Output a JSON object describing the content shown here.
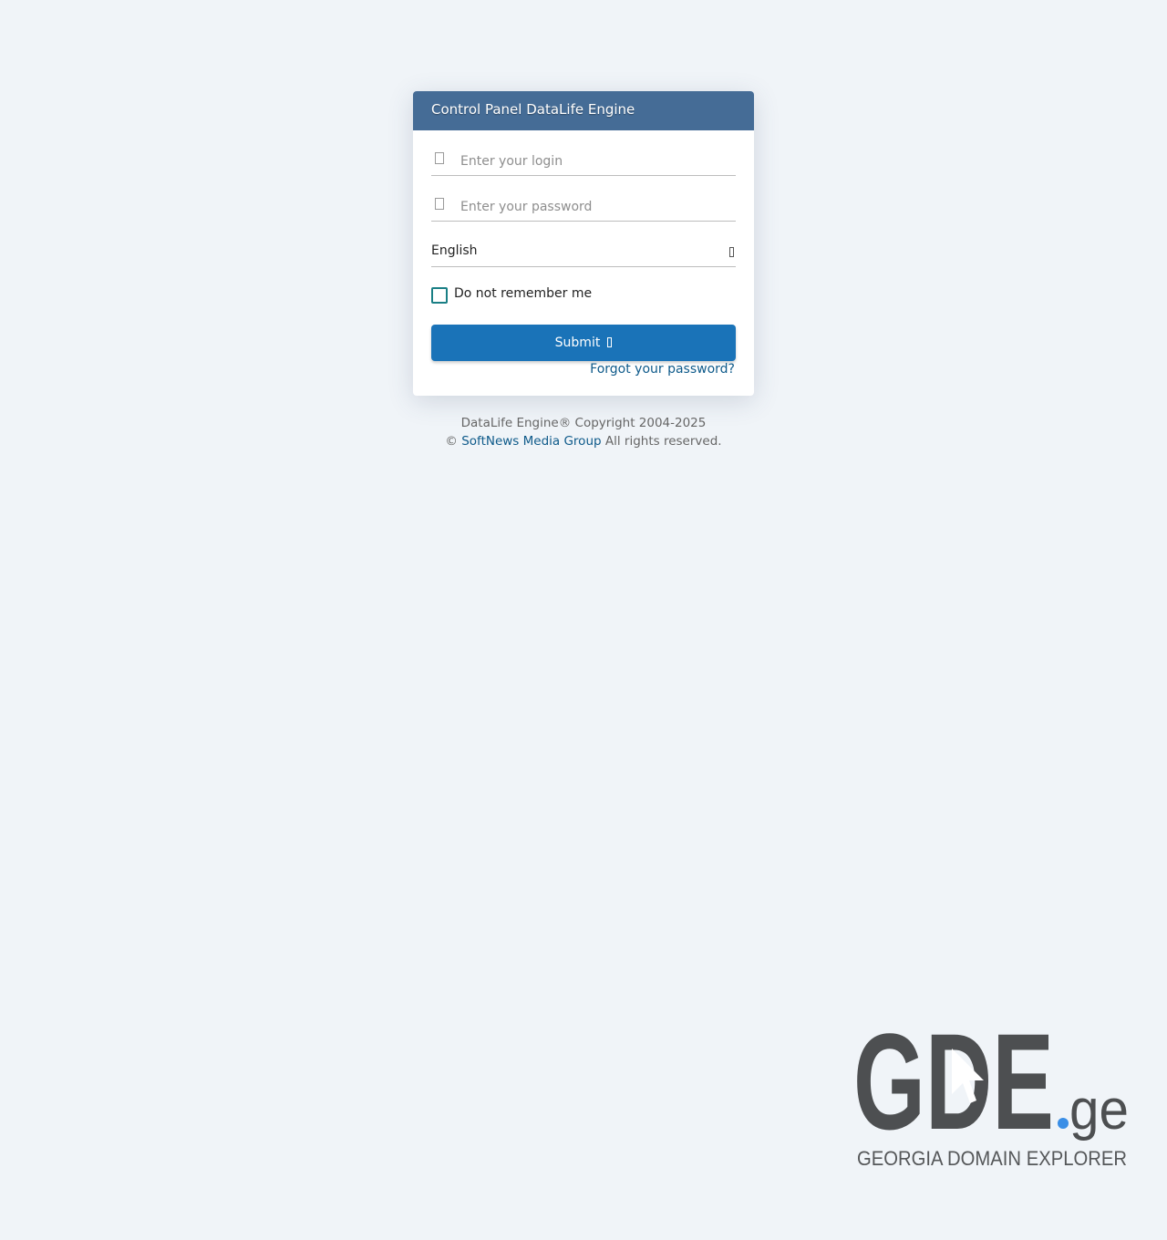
{
  "login_panel": {
    "title": "Control Panel DataLife Engine",
    "login_field": {
      "placeholder": "Enter your login",
      "value": "",
      "icon": "user-icon"
    },
    "password_field": {
      "placeholder": "Enter your password",
      "value": "",
      "icon": "lock-icon"
    },
    "language_select": {
      "value": "English",
      "icon": "chevron-down-icon"
    },
    "remember_checkbox": {
      "label": "Do not remember me",
      "checked": false
    },
    "submit_button": {
      "label": "Submit",
      "icon": "sign-in-icon"
    },
    "forgot_link": "Forgot your password?"
  },
  "footer": {
    "copyright": "DataLife Engine® Copyright 2004-2025",
    "prefix": "©",
    "company_link": "SoftNews Media Group",
    "rights": "All rights reserved."
  },
  "logo": {
    "wordmark": "GDE",
    "tld": ".ge",
    "tagline": "GEORGIA DOMAIN EXPLORER"
  },
  "colors": {
    "background": "#f0f4f8",
    "header": "#456c96",
    "button": "#1a73b8",
    "link": "#0e5a8a",
    "checkbox_border": "#1a7f85",
    "logo_dark": "#4d4f51",
    "logo_dot": "#3a8ee6"
  }
}
